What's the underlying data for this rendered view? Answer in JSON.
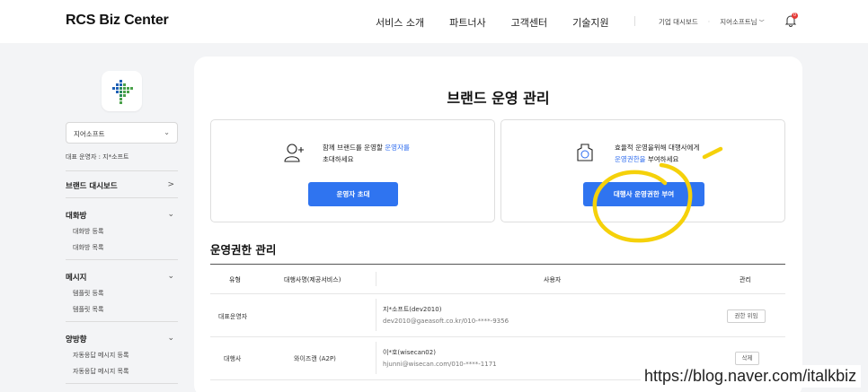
{
  "header": {
    "logo": "RCS Biz Center",
    "nav": [
      "서비스 소개",
      "파트너사",
      "고객센터",
      "기술지원"
    ],
    "corp_dashboard": "기업 대시보드",
    "user_menu": "지어소프트님",
    "notification_count": "0"
  },
  "sidebar": {
    "brand_select": "지어소프트",
    "representative": "대표 운영자 : 지*소프트",
    "menu": [
      {
        "label": "브랜드 대시보드",
        "arrow": ">"
      },
      {
        "label": "대화방",
        "arrow": "⌄",
        "children": [
          "대화방 등록",
          "대화방 목록"
        ]
      },
      {
        "label": "메시지",
        "arrow": "⌄",
        "children": [
          "템플릿 등록",
          "템플릿 목록"
        ]
      },
      {
        "label": "양방향",
        "arrow": "⌄",
        "children": [
          "자동응답 메시지 등록",
          "자동응답 메시지 목록"
        ]
      }
    ]
  },
  "main": {
    "title": "브랜드 운영 관리",
    "invite_box": {
      "text_prefix": "함께 브랜드를 운영할 ",
      "text_highlight": "운영자를",
      "text_line2": "초대하세요",
      "button": "운영자 초대"
    },
    "agency_box": {
      "text_line1": "효율적 운영을위해 대행사에게",
      "text_highlight": "운영권한을",
      "text_suffix": " 부여하세요",
      "button": "대행사 운영권한 부여"
    },
    "section_title": "운영권한 관리",
    "table": {
      "headers": [
        "유형",
        "대행사명(제공서비스)",
        "사용자",
        "관리"
      ],
      "rows": [
        {
          "type": "대표운영자",
          "agency": "",
          "user_name": "지*소프트(dev2010)",
          "user_contact": "dev2010@gaeasoft.co.kr/010-****-9356",
          "action": "권한 위임"
        },
        {
          "type": "대행사",
          "agency": "와이즈캔 (A2P)",
          "user_name": "이*호(wisecan02)",
          "user_contact": "hjunni@wisecan.com/010-****-1171",
          "action": "삭제"
        }
      ]
    }
  },
  "watermark": "https://blog.naver.com/italkbiz",
  "colors": {
    "accent_blue": "#2f74f0",
    "highlight_yellow": "#f5d10a",
    "bg": "#f3f4f6"
  }
}
